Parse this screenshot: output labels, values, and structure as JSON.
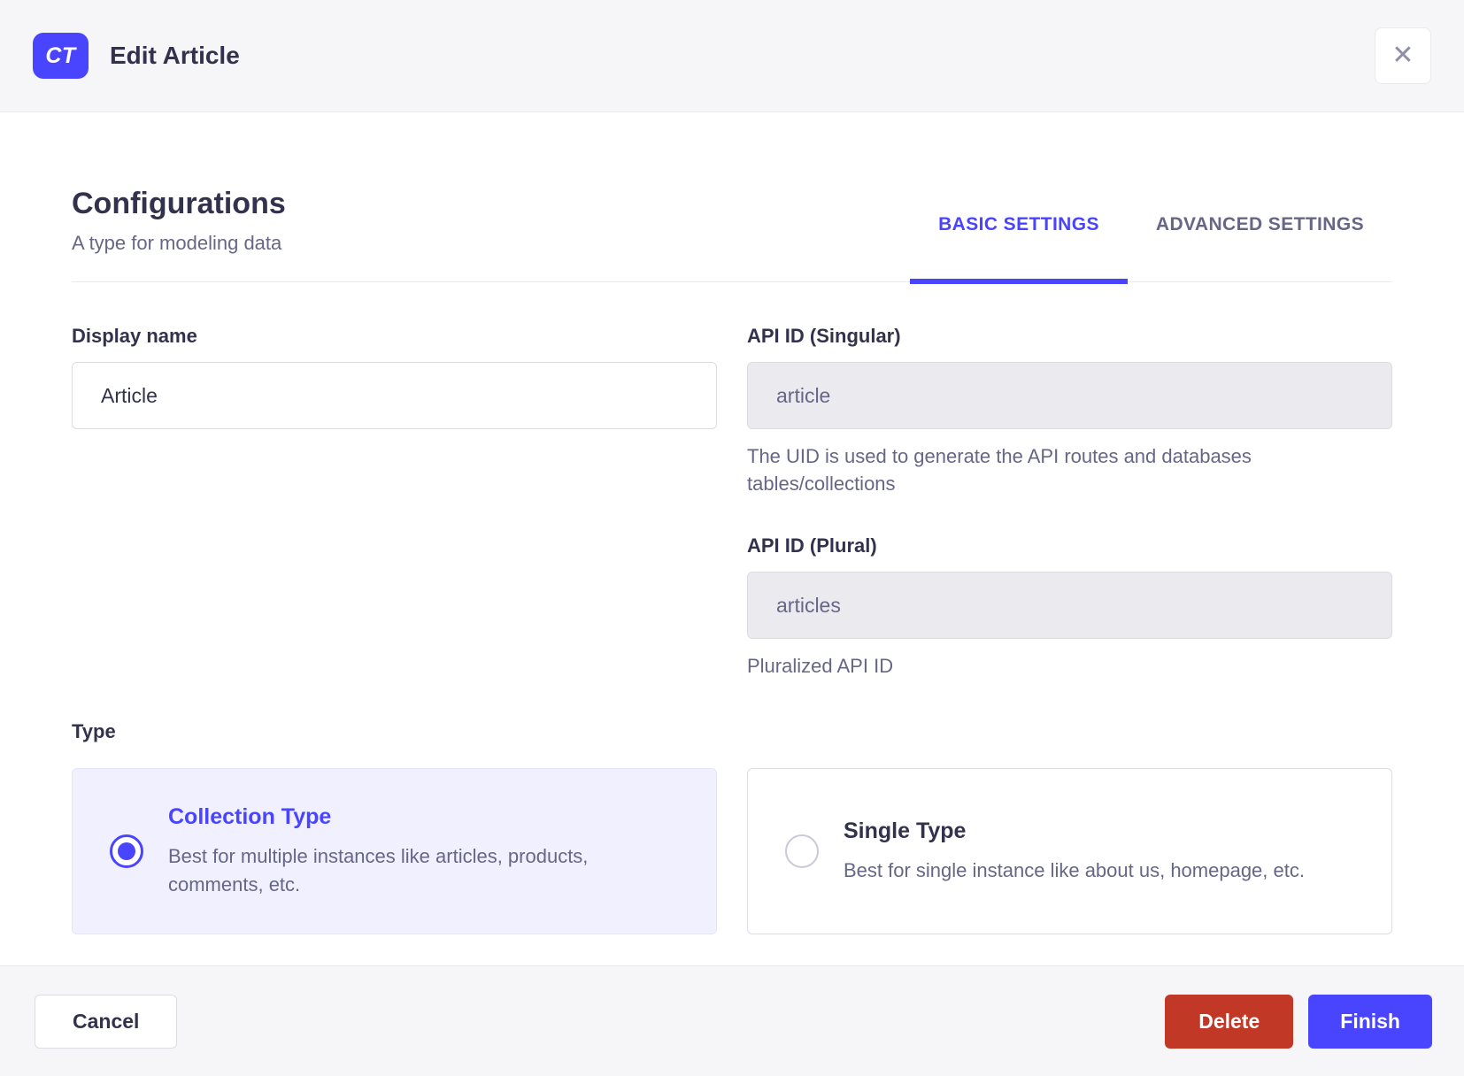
{
  "header": {
    "badge": "CT",
    "title": "Edit Article",
    "close_glyph": "✕"
  },
  "section": {
    "title": "Configurations",
    "subtitle": "A type for modeling data"
  },
  "tabs": [
    {
      "label": "BASIC SETTINGS",
      "active": true
    },
    {
      "label": "ADVANCED SETTINGS",
      "active": false
    }
  ],
  "fields": {
    "display_name": {
      "label": "Display name",
      "value": "Article"
    },
    "api_id_singular": {
      "label": "API ID (Singular)",
      "value": "article",
      "hint": "The UID is used to generate the API routes and databases tables/collections",
      "disabled": true
    },
    "api_id_plural": {
      "label": "API ID (Plural)",
      "value": "articles",
      "hint": "Pluralized API ID",
      "disabled": true
    }
  },
  "type_section": {
    "label": "Type",
    "options": [
      {
        "title": "Collection Type",
        "description": "Best for multiple instances like articles, products, comments, etc.",
        "selected": true
      },
      {
        "title": "Single Type",
        "description": "Best for single instance like about us, homepage, etc.",
        "selected": false
      }
    ]
  },
  "footer": {
    "cancel_label": "Cancel",
    "delete_label": "Delete",
    "finish_label": "Finish"
  },
  "colors": {
    "primary": "#4945ff",
    "danger": "#c13826",
    "selected_card_bg": "#f0f0ff",
    "header_bg": "#f6f6f9",
    "border": "#eaeaef",
    "text_dark": "#32324d",
    "text_muted": "#666687"
  }
}
